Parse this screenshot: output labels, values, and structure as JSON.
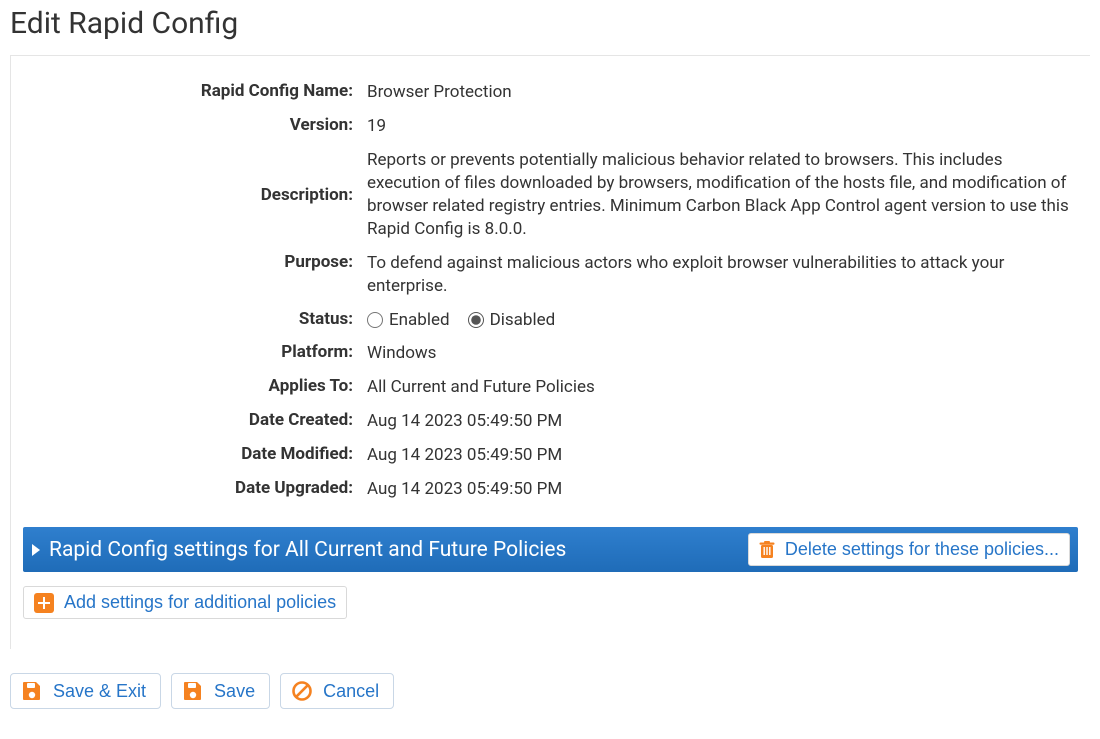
{
  "page": {
    "title": "Edit Rapid Config"
  },
  "labels": {
    "name": "Rapid Config Name:",
    "version": "Version:",
    "description": "Description:",
    "purpose": "Purpose:",
    "status": "Status:",
    "platform": "Platform:",
    "applies_to": "Applies To:",
    "date_created": "Date Created:",
    "date_modified": "Date Modified:",
    "date_upgraded": "Date Upgraded:"
  },
  "fields": {
    "name": "Browser Protection",
    "version": "19",
    "description": "Reports or prevents potentially malicious behavior related to browsers. This includes execution of files downloaded by browsers, modification of the hosts file, and modification of browser related registry entries. Minimum Carbon Black App Control agent version to use this Rapid Config is 8.0.0.",
    "purpose": "To defend against malicious actors who exploit browser vulnerabilities to attack your enterprise.",
    "platform": "Windows",
    "applies_to": "All Current and Future Policies",
    "date_created": "Aug 14 2023 05:49:50 PM",
    "date_modified": "Aug 14 2023 05:49:50 PM",
    "date_upgraded": "Aug 14 2023 05:49:50 PM"
  },
  "status": {
    "options": {
      "enabled": "Enabled",
      "disabled": "Disabled"
    },
    "selected": "disabled"
  },
  "settings_bar": {
    "title": "Rapid Config settings for All Current and Future Policies",
    "delete_label": "Delete settings for these policies..."
  },
  "add_button": {
    "label": "Add settings for additional policies"
  },
  "footer": {
    "save_exit": "Save & Exit",
    "save": "Save",
    "cancel": "Cancel"
  },
  "colors": {
    "accent_orange": "#f58220",
    "accent_blue": "#2675c8"
  }
}
